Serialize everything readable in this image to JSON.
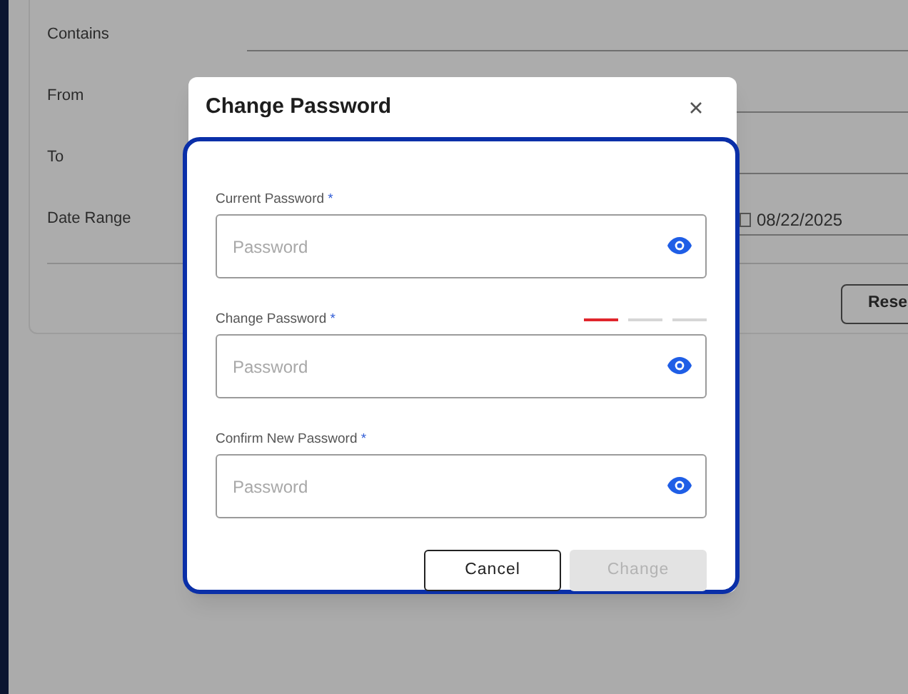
{
  "filters": [
    {
      "label": "Contains"
    },
    {
      "label": "From"
    },
    {
      "label": "To"
    },
    {
      "label": "Date Range",
      "value": "08/22/2025"
    }
  ],
  "reset_button": "Rese",
  "dialog": {
    "title": "Change Password",
    "fields": [
      {
        "label": "Current Password",
        "required": "*",
        "placeholder": "Password"
      },
      {
        "label": "Change Password",
        "required": "*",
        "placeholder": "Password",
        "strength": [
          {
            "on": true
          },
          {
            "on": false
          },
          {
            "on": false
          }
        ]
      },
      {
        "label": "Confirm New Password",
        "required": "*",
        "placeholder": "Password"
      }
    ],
    "buttons": [
      {
        "label": "Cancel",
        "disabled": false
      },
      {
        "label": "Change",
        "disabled": true
      }
    ]
  }
}
